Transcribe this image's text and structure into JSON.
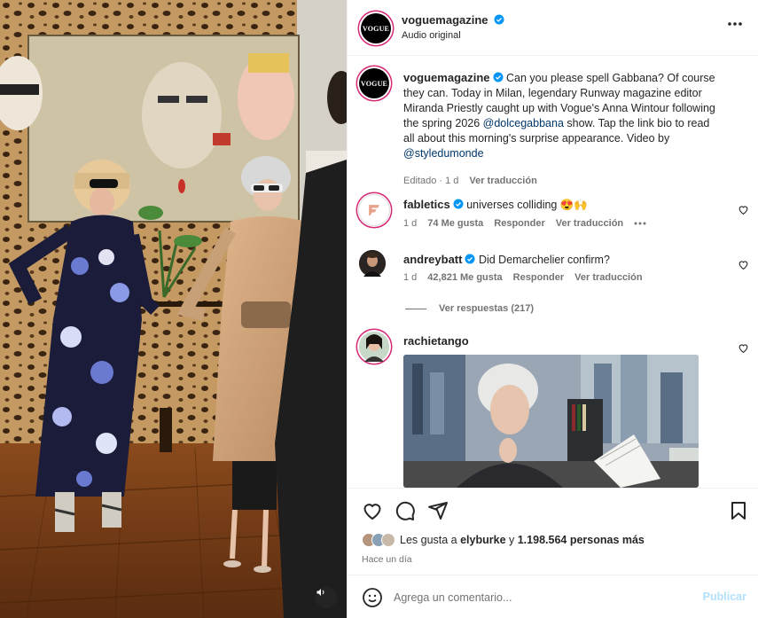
{
  "colors": {
    "accent": "#0095f6",
    "verified": "#0095f6",
    "link": "#00376b",
    "muted": "#737373",
    "post_disabled": "#b2dffc"
  },
  "media": {
    "kind": "video",
    "mute_icon": "speaker-icon"
  },
  "header": {
    "avatar_text": "VOGUE",
    "username": "voguemagazine",
    "subtitle": "Audio original",
    "more_icon": "more-horizontal-icon"
  },
  "caption": {
    "avatar_text": "VOGUE",
    "username": "voguemagazine",
    "text_1": "Can you please spell Gabbana? Of course they can. Today in Milan, legendary Runway magazine editor Miranda Priestly caught up with Vogue's Anna Wintour following the spring 2026 ",
    "mention_1": "@dolcegabbana",
    "text_2": " show. Tap the link bio to read all about this morning's surprise appearance. Video by ",
    "mention_2": "@styledumonde",
    "edited": "Editado · 1 d",
    "translate": "Ver traducción"
  },
  "comments": [
    {
      "username": "fabletics",
      "verified": true,
      "text": "universes colliding 😍🙌",
      "time": "1 d",
      "likes": "74 Me gusta",
      "reply": "Responder",
      "translate": "Ver traducción",
      "has_more": true
    },
    {
      "username": "andreybatt",
      "verified": true,
      "text": "Did Demarchelier confirm?",
      "time": "1 d",
      "likes": "42,821 Me gusta",
      "reply": "Responder",
      "translate": "Ver traducción",
      "has_more": false
    },
    {
      "username": "rachietango",
      "verified": false,
      "text": "",
      "has_gif": true
    }
  ],
  "replies_toggle": "Ver respuestas (217)",
  "actions": {
    "like_icon": "heart-icon",
    "comment_icon": "comment-icon",
    "share_icon": "share-icon",
    "save_icon": "bookmark-icon"
  },
  "likes": {
    "prefix": "Les gusta a ",
    "user": "elyburke",
    "middle": " y ",
    "count": "1.198.564 personas más"
  },
  "timestamp": "Hace un día",
  "add_comment": {
    "placeholder": "Agrega un comentario...",
    "post_label": "Publicar",
    "emoji_icon": "emoji-icon"
  }
}
